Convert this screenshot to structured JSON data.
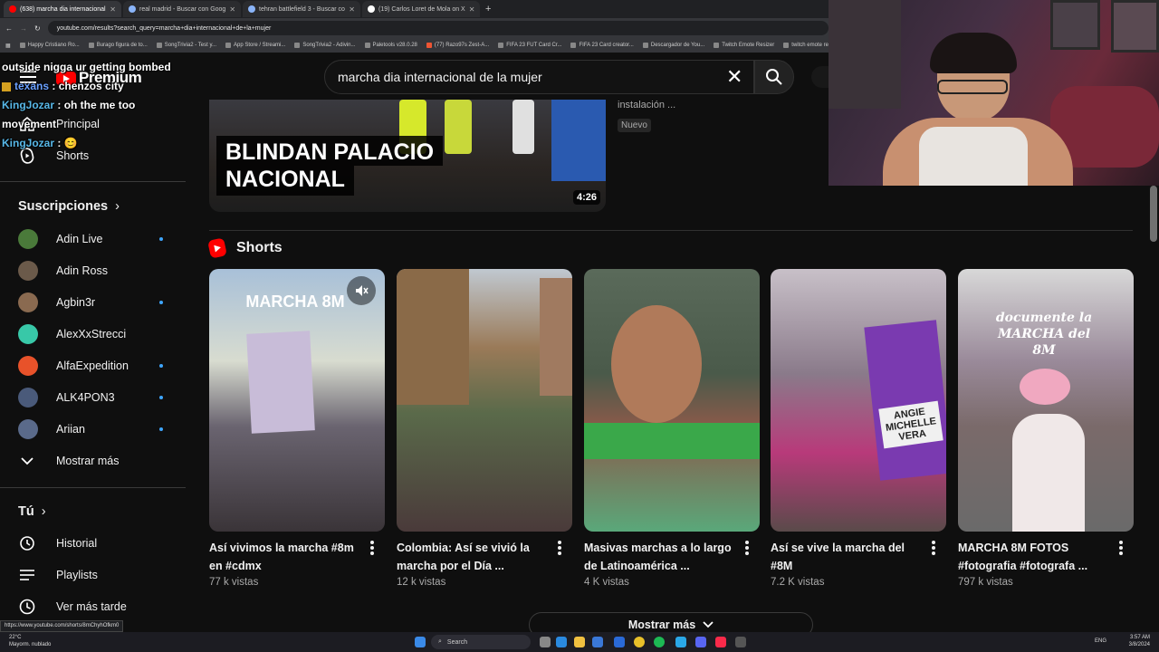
{
  "browser": {
    "tabs": [
      {
        "title": "(638) marcha dia internacional",
        "active": true,
        "color": "#ff0000"
      },
      {
        "title": "real madrid - Buscar con Goog",
        "active": false,
        "color": "#8ab4f8"
      },
      {
        "title": "tehran battlefield 3 - Buscar co",
        "active": false,
        "color": "#8ab4f8"
      },
      {
        "title": "(19) Carlos Loret de Mola on X",
        "active": false,
        "color": "#ffffff"
      }
    ],
    "new_tab": "+",
    "url": "youtube.com/results?search_query=marcha+dia+internacional+de+la+mujer",
    "bookmarks": [
      "Happy Cristiano Ro...",
      "Burago figura de to...",
      "SongTrivia2 - Test y...",
      "App Store / Streami...",
      "SongTrivia2 - Adivin...",
      "Paletools v28.0.28",
      "(77) Razo97s Zest-A...",
      "FIFA 23 FUT Card Cr...",
      "FIFA 23 Card creator...",
      "Descargador de You...",
      "Twitch Emote Resizer",
      "twitch emote re"
    ]
  },
  "youtube": {
    "logo_text": "Premium",
    "search_value": "marcha dia internacional de la mujer"
  },
  "chat": [
    {
      "user": "",
      "text": "outside nigga ur getting bombed"
    },
    {
      "user": "texans",
      "text": "chenzos city"
    },
    {
      "user": "KingJozar",
      "text": "oh the me too movement"
    },
    {
      "user": "KingJozar",
      "text": "😊"
    }
  ],
  "sidebar": {
    "nav": [
      {
        "label": "Principal",
        "icon": "home-icon"
      },
      {
        "label": "Shorts",
        "icon": "shorts-icon"
      }
    ],
    "subscriptions_title": "Suscripciones",
    "subscriptions": [
      {
        "name": "Adin Live",
        "color": "#4a7a3a",
        "new": true
      },
      {
        "name": "Adin Ross",
        "color": "#6b5a4a",
        "new": false
      },
      {
        "name": "Agbin3r",
        "color": "#8a6a50",
        "new": true
      },
      {
        "name": "AlexXxStrecci",
        "color": "#38c8a8",
        "new": false
      },
      {
        "name": "AlfaExpedition",
        "color": "#e8522a",
        "new": true
      },
      {
        "name": "ALK4PON3",
        "color": "#4a5a7a",
        "new": true
      },
      {
        "name": "Ariian",
        "color": "#5a6a8a",
        "new": true
      }
    ],
    "show_more": "Mostrar más",
    "you_title": "Tú",
    "you_items": [
      {
        "label": "Historial",
        "icon": "history-icon"
      },
      {
        "label": "Playlists",
        "icon": "playlists-icon"
      },
      {
        "label": "Ver más tarde",
        "icon": "watch-later-icon"
      }
    ]
  },
  "video": {
    "caption_line1": "BLINDAN PALACIO",
    "caption_line2": "NACIONAL",
    "duration": "4:26",
    "description": "instalación ...",
    "badge": "Nuevo"
  },
  "shorts": {
    "title": "Shorts",
    "items": [
      {
        "title": "Así vivimos la marcha #8m  en #cdmx",
        "views": "77 k vistas",
        "overlay": "MARCHA 8M"
      },
      {
        "title": "Colombia: Así se vivió la marcha por el Día ...",
        "views": "12 k vistas",
        "overlay": ""
      },
      {
        "title": "Masivas marchas a lo largo de Latinoamérica ...",
        "views": "4 K vistas",
        "overlay": ""
      },
      {
        "title": "Así se vive la marcha del #8M",
        "views": "7.2 K vistas",
        "overlay": "ANGIE MICHELLE VERA"
      },
      {
        "title": "MARCHA 8M FOTOS #fotografia #fotografa ...",
        "views": "797 k vistas",
        "overlay": "documente la MARCHA del 8M"
      }
    ],
    "show_more": "Mostrar más"
  },
  "statusbar_url": "https://www.youtube.com/shorts/8mChyhOfkm0",
  "taskbar": {
    "weather_temp": "22°C",
    "weather_desc": "Mayorm. nublado",
    "search": "Search",
    "lang": "ENG",
    "time": "3:57 AM",
    "date": "3/8/2024"
  }
}
